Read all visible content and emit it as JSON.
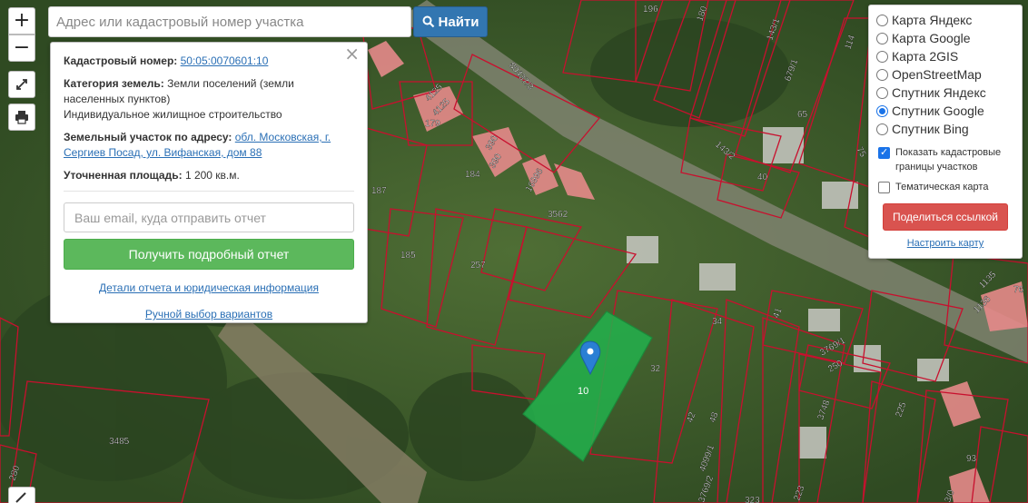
{
  "search": {
    "placeholder": "Адрес или кадастровый номер участка",
    "button_label": "Найти"
  },
  "controls": {
    "zoom_in": "+",
    "zoom_out": "−"
  },
  "info": {
    "close": "×",
    "cadastral_label": "Кадастровый номер:",
    "cadastral_value": "50:05:0070601:10",
    "category_label": "Категория земель:",
    "category_value": "Земли поселений (земли населенных пунктов)",
    "usage_value": "Индивидуальное жилищное строительство",
    "address_label": "Земельный участок по адресу:",
    "address_value": "обл. Московская, г. Сергиев Посад, ул. Вифанская, дом 88",
    "area_label": "Уточненная площадь:",
    "area_value": "1 200 кв.м.",
    "email_placeholder": "Ваш email, куда отправить отчет",
    "report_button": "Получить подробный отчет",
    "details_link": "Детали отчета и юридическая информация",
    "manual_link": "Ручной выбор вариантов"
  },
  "layers": {
    "options": [
      {
        "label": "Карта Яндекс",
        "selected": false
      },
      {
        "label": "Карта Google",
        "selected": false
      },
      {
        "label": "Карта 2GIS",
        "selected": false
      },
      {
        "label": "OpenStreetMap",
        "selected": false
      },
      {
        "label": "Спутник Яндекс",
        "selected": false
      },
      {
        "label": "Спутник Google",
        "selected": true
      },
      {
        "label": "Спутник Bing",
        "selected": false
      }
    ],
    "show_cadastral": "Показать кадастровые границы участков",
    "show_cadastral_checked": true,
    "thematic": "Тематическая карта",
    "thematic_checked": false,
    "share_button": "Поделиться ссылкой",
    "settings_link": "Настроить карту"
  },
  "map": {
    "selected_parcel_label": "10",
    "parcel_labels": [
      "196",
      "180",
      "143/1",
      "679/1",
      "114",
      "80437/3",
      "4125",
      "4125",
      "179",
      "390",
      "390",
      "184",
      "16996",
      "3562",
      "143/2",
      "40",
      "65",
      "75",
      "187",
      "185",
      "257",
      "34",
      "41",
      "3769/1",
      "250",
      "32",
      "3748",
      "225",
      "42",
      "48",
      "4099/1",
      "3769/2",
      "323",
      "223",
      "3485",
      "280",
      "1135",
      "1136",
      "76",
      "93",
      "3/0"
    ],
    "colors": {
      "boundary": "#c8102e",
      "selected_fill": "#22b14c",
      "marker": "#2a7fd4"
    }
  }
}
